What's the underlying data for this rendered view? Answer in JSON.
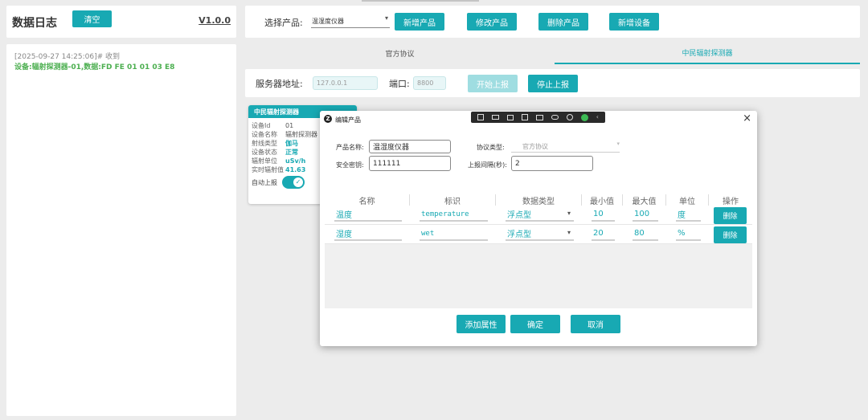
{
  "log_panel": {
    "title": "数据日志",
    "clear_label": "清空",
    "version": "V1.0.0",
    "entry_time": "[2025-09-27 14:25:06]# 收到",
    "entry_data": "设备:辐射探测器-01,数据:FD FE 01 01 03 E8"
  },
  "top_bar": {
    "select_label": "选择产品:",
    "select_value": "温湿度仪器",
    "buttons": {
      "add_product": "新增产品",
      "edit_product": "修改产品",
      "delete_product": "删除产品",
      "add_device": "新增设备"
    }
  },
  "tabs": {
    "official": "官方协议",
    "zhongmin": "中民辐射探测器"
  },
  "server": {
    "address_label": "服务器地址:",
    "address_placeholder": "127.0.0.1",
    "port_label": "端口:",
    "port_placeholder": "8800",
    "start_label": "开始上报",
    "stop_label": "停止上报"
  },
  "device_card": {
    "title": "中民辐射探测器",
    "rows": [
      {
        "key": "设备Id",
        "value": "01",
        "highlight": false
      },
      {
        "key": "设备名称",
        "value": "辐射探测器",
        "highlight": false
      },
      {
        "key": "射线类型",
        "value": "伽马",
        "highlight": true
      },
      {
        "key": "设备状态",
        "value": "正常",
        "highlight": true
      },
      {
        "key": "辐射单位",
        "value": "uSv/h",
        "highlight": true
      },
      {
        "key": "实时辐射值",
        "value": "41.63",
        "highlight": true
      }
    ],
    "auto_report_label": "自动上报",
    "auto_report_on": true
  },
  "dialog": {
    "logo": "Z",
    "title": "编辑产品",
    "close_symbol": "×",
    "form": {
      "name_label": "产品名称:",
      "name_value": "温湿度仪器",
      "protocol_label": "协议类型:",
      "protocol_value": "官方协议",
      "secret_label": "安全密钥:",
      "secret_value": "111111",
      "interval_label": "上报间隔(秒):",
      "interval_value": "2"
    },
    "table": {
      "headers": [
        "名称",
        "标识",
        "数据类型",
        "最小值",
        "最大值",
        "单位",
        "操作"
      ],
      "rows": [
        {
          "name": "温度",
          "id": "temperature",
          "type": "浮点型",
          "min": "10",
          "max": "100",
          "unit": "度",
          "action": "删除"
        },
        {
          "name": "湿度",
          "id": "wet",
          "type": "浮点型",
          "min": "20",
          "max": "80",
          "unit": "%",
          "action": "删除"
        }
      ]
    },
    "buttons": {
      "add_attr": "添加属性",
      "confirm": "确定",
      "cancel": "取消"
    }
  },
  "colors": {
    "accent": "#18a9b3",
    "green_text": "#4caf50",
    "teal_text": "#18a9b3"
  }
}
